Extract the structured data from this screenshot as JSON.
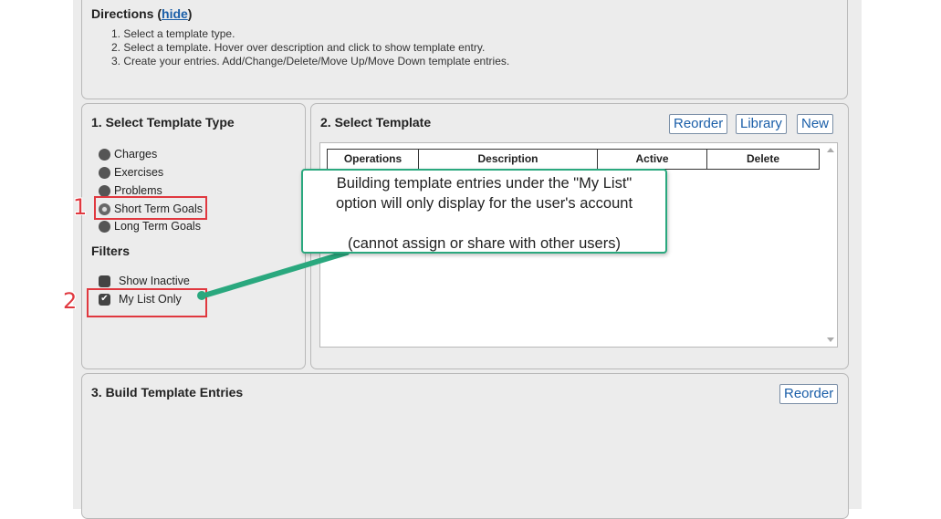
{
  "directions": {
    "title": "Directions (",
    "hide_link": "hide",
    "title_close": ")",
    "steps": [
      "1. Select a template type.",
      "2. Select a template. Hover over description and click to show template entry.",
      "3. Create your entries. Add/Change/Delete/Move Up/Move Down template entries."
    ]
  },
  "template_type": {
    "title": "1. Select Template Type",
    "options": [
      "Charges",
      "Exercises",
      "Problems",
      "Short Term Goals",
      "Long Term Goals"
    ],
    "selected": "Short Term Goals"
  },
  "filters": {
    "title": "Filters",
    "show_inactive": {
      "label": "Show Inactive",
      "checked": false
    },
    "my_list_only": {
      "label": "My List Only",
      "checked": true
    }
  },
  "select_template": {
    "title": "2. Select Template",
    "buttons": {
      "reorder": "Reorder",
      "library": "Library",
      "new": "New"
    },
    "columns": [
      "Operations",
      "Description",
      "Active",
      "Delete"
    ]
  },
  "build_entries": {
    "title": "3. Build Template Entries",
    "reorder_label": "Reorder"
  },
  "annotations": {
    "step1": "1",
    "step2": "2",
    "callout_line1": "Building template entries under the \"My List\"",
    "callout_line2": "option will only display for the user's account",
    "callout_line3": "(cannot assign or share with other users)",
    "highlight_color": "#e0383f",
    "callout_color": "#2aa87e"
  }
}
